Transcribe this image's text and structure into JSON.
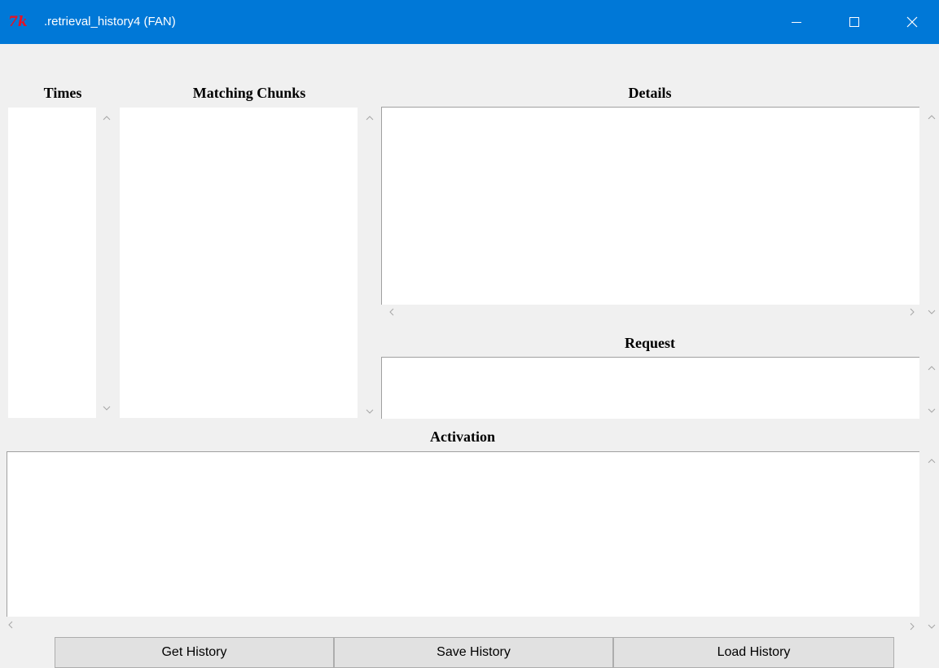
{
  "window": {
    "icon_text": "7k",
    "title": ".retrieval_history4 (FAN)",
    "controls": [
      "minimize-icon",
      "maximize-icon",
      "close-icon"
    ],
    "titlebar_color": "#0078d7"
  },
  "panes": {
    "times_label": "Times",
    "chunks_label": "Matching Chunks",
    "details_label": "Details",
    "request_label": "Request",
    "activation_label": "Activation"
  },
  "buttons": {
    "get_label": "Get History",
    "save_label": "Save History",
    "load_label": "Load History"
  }
}
